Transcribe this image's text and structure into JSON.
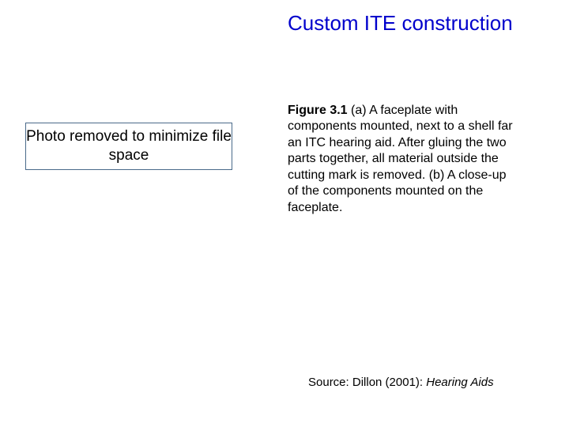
{
  "title": "Custom ITE construction",
  "photo_placeholder": "Photo removed to minimize file space",
  "caption": {
    "label": "Figure 3.1",
    "text": "  (a) A faceplate with components mounted, next to a shell far an ITC hearing aid. After gluing the two parts together, all material outside the cutting mark is removed. (b) A close-up of the components mounted on the faceplate."
  },
  "source": {
    "prefix": "Source:  Dillon (2001): ",
    "title": "Hearing Aids"
  }
}
